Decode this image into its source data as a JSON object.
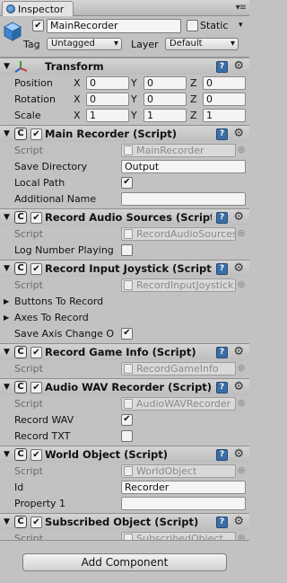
{
  "tab": {
    "label": "Inspector"
  },
  "object": {
    "name": "MainRecorder",
    "static_label": "Static",
    "tag_label": "Tag",
    "tag_value": "Untagged",
    "layer_label": "Layer",
    "layer_value": "Default"
  },
  "transform": {
    "title": "Transform",
    "rows": [
      {
        "label": "Position",
        "x": "0",
        "y": "0",
        "z": "0"
      },
      {
        "label": "Rotation",
        "x": "0",
        "y": "0",
        "z": "0"
      },
      {
        "label": "Scale",
        "x": "1",
        "y": "1",
        "z": "1"
      }
    ],
    "axes": [
      "X",
      "Y",
      "Z"
    ]
  },
  "script_label": "Script",
  "components": {
    "main_recorder": {
      "title": "Main Recorder (Script)",
      "script": "MainRecorder",
      "save_directory_label": "Save Directory",
      "save_directory_value": "Output",
      "local_path_label": "Local Path",
      "additional_name_label": "Additional Name",
      "additional_name_value": ""
    },
    "record_audio_sources": {
      "title": "Record Audio Sources (Script)",
      "script": "RecordAudioSources",
      "log_label": "Log Number Playing"
    },
    "record_input_joystick": {
      "title": "Record Input Joystick (Script)",
      "script": "RecordInputJoystick",
      "buttons_label": "Buttons To Record",
      "axes_label": "Axes To Record",
      "save_axis_label": "Save Axis Change O"
    },
    "record_game_info": {
      "title": "Record Game Info (Script)",
      "script": "RecordGameInfo"
    },
    "audio_wav_recorder": {
      "title": "Audio WAV Recorder (Script)",
      "script": "AudioWAVRecorder",
      "record_wav_label": "Record WAV",
      "record_txt_label": "Record TXT"
    },
    "world_object": {
      "title": "World Object (Script)",
      "script": "WorldObject",
      "id_label": "Id",
      "id_value": "Recorder",
      "property_label": "Property 1",
      "property_value": ""
    },
    "subscribed_object": {
      "title": "Subscribed Object (Script)",
      "script": "SubscribedObject"
    }
  },
  "add_component_label": "Add Component",
  "icons": {
    "help": "help-book-icon",
    "gear": "gear-icon",
    "check": "✔",
    "foldout_open": "▼",
    "foldout_closed": "▶",
    "picker": "◎"
  }
}
